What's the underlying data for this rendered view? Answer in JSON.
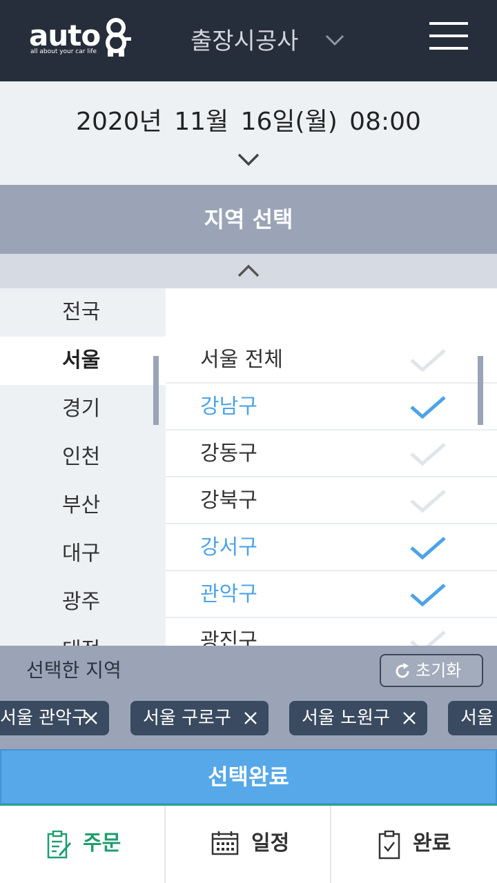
{
  "header": {
    "logo_text": "auto",
    "logo_tagline": "all about your car life",
    "title": "출장시공사"
  },
  "date": {
    "text": "2020년 11월 16일(월) 08:00"
  },
  "region": {
    "title": "지역 선택",
    "left_items": [
      {
        "label": "전국"
      },
      {
        "label": "서울"
      },
      {
        "label": "경기"
      },
      {
        "label": "인천"
      },
      {
        "label": "부산"
      },
      {
        "label": "대구"
      },
      {
        "label": "광주"
      },
      {
        "label": "대전"
      }
    ],
    "active_left": "서울",
    "right_items": [
      {
        "label": "서울 전체",
        "selected": false
      },
      {
        "label": "강남구",
        "selected": true
      },
      {
        "label": "강동구",
        "selected": false
      },
      {
        "label": "강북구",
        "selected": false
      },
      {
        "label": "강서구",
        "selected": true
      },
      {
        "label": "관악구",
        "selected": true
      },
      {
        "label": "광진구",
        "selected": false
      }
    ]
  },
  "selected": {
    "label": "선택한 지역",
    "reset_label": "초기화",
    "chips": [
      {
        "label": "서울 관악구"
      },
      {
        "label": "서울 구로구"
      },
      {
        "label": "서울 노원구"
      },
      {
        "label": "서울"
      }
    ]
  },
  "confirm_label": "선택완료",
  "bottom_nav": [
    {
      "label": "주문",
      "icon": "order-edit-icon",
      "active": true
    },
    {
      "label": "일정",
      "icon": "calendar-icon",
      "active": false
    },
    {
      "label": "완료",
      "icon": "clipboard-check-icon",
      "active": false
    }
  ],
  "colors": {
    "header_bg": "#272e3b",
    "accent_blue": "#4da3e8",
    "confirm_bg": "#56a8e8",
    "panel_bg": "#9aa4b6",
    "chip_bg": "#3a4a60",
    "nav_active": "#1e9d6f"
  }
}
